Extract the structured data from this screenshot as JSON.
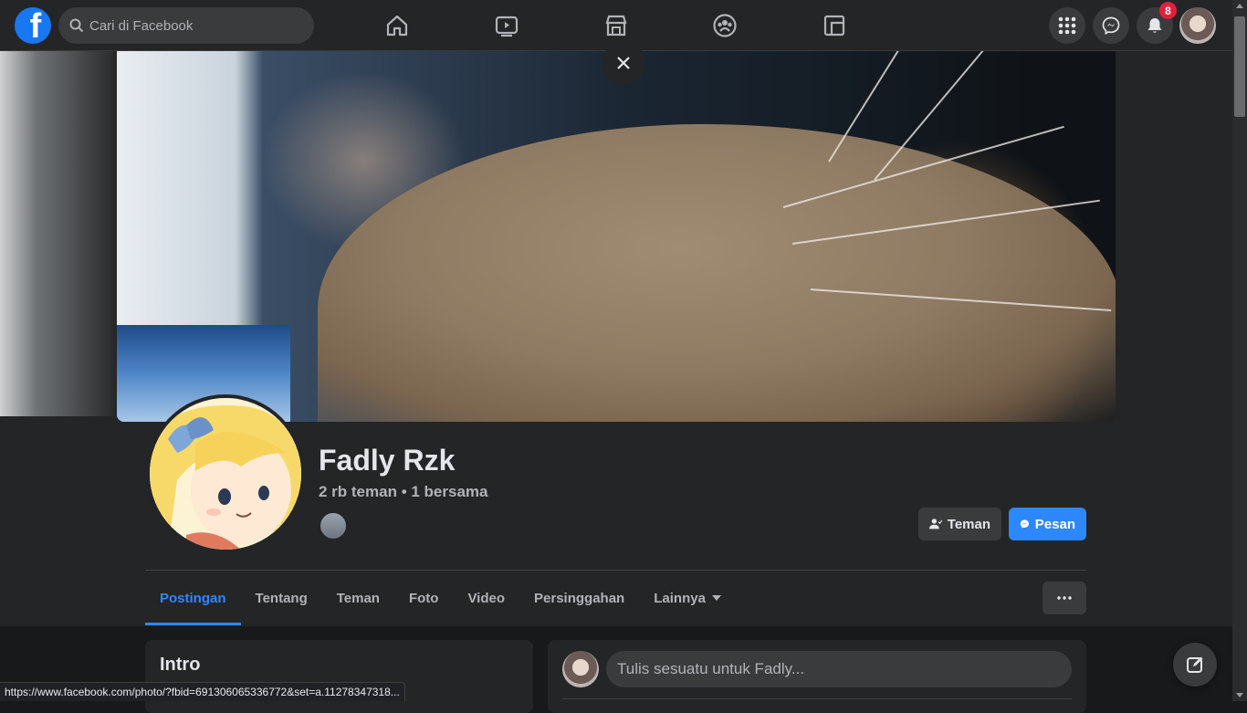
{
  "topbar": {
    "logo_letter": "f",
    "search": {
      "placeholder": "Cari di Facebook"
    },
    "nav": [
      "home-icon",
      "watch-icon",
      "marketplace-icon",
      "groups-icon",
      "gaming-icon"
    ],
    "right": {
      "notifications_count": "8"
    }
  },
  "profile": {
    "name": "Fadly Rzk",
    "friends_line": "2 rb teman • 1 bersama",
    "buttons": {
      "friend": "Teman",
      "message": "Pesan"
    }
  },
  "tabs": [
    {
      "label": "Postingan",
      "active": true
    },
    {
      "label": "Tentang"
    },
    {
      "label": "Teman"
    },
    {
      "label": "Foto"
    },
    {
      "label": "Video"
    },
    {
      "label": "Persinggahan"
    },
    {
      "label": "Lainnya"
    }
  ],
  "intro": {
    "title": "Intro"
  },
  "composer": {
    "placeholder": "Tulis sesuatu untuk Fadly..."
  },
  "status_bar": {
    "url": "https://www.facebook.com/photo/?fbid=691306065336772&set=a.11278347318..."
  },
  "colors": {
    "accent": "#2d88ff",
    "badge": "#e41e3f",
    "surface": "#242526",
    "background": "#18191a"
  }
}
